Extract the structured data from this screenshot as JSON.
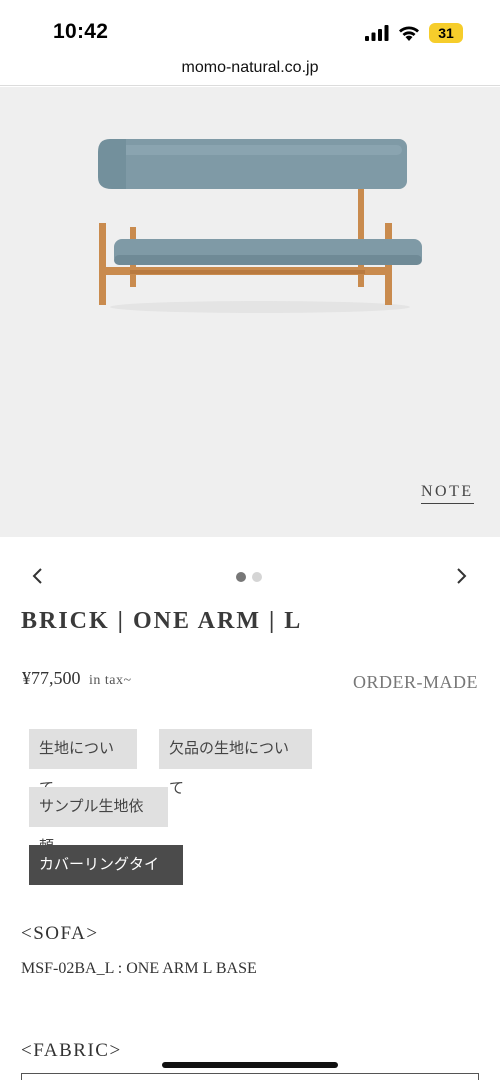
{
  "status_bar": {
    "time": "10:42",
    "battery": "31"
  },
  "browser": {
    "url": "momo-natural.co.jp"
  },
  "hero": {
    "note_label": "NOTE",
    "dot_count": 2,
    "active_dot": 0
  },
  "product": {
    "title": "BRICK | ONE ARM | L",
    "price": "¥77,500",
    "tax_label": "in tax~",
    "order_made": "ORDER-MADE"
  },
  "tags": {
    "fabric": "生地について",
    "missing_fabric": "欠品の生地について",
    "sample": "サンプル生地依頼",
    "covering": "カバーリングタイプ"
  },
  "sections": {
    "sofa_heading": "<SOFA>",
    "sofa_model": "MSF-02BA_L : ONE ARM L BASE",
    "fabric_heading": "<FABRIC>"
  },
  "colors": {
    "fabric_blue": "#7f9aa6",
    "wood": "#c98b4e",
    "hero_bg": "#efefef"
  }
}
